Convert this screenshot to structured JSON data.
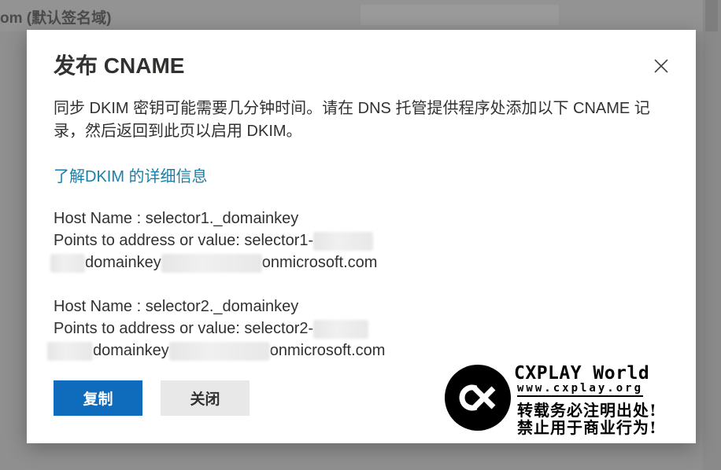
{
  "background": {
    "page_title": "om (默认签名域)"
  },
  "dialog": {
    "title": "发布 CNAME",
    "description": "同步 DKIM 密钥可能需要几分钟时间。请在 DNS 托管提供程序处添加以下 CNAME 记录，然后返回到此页以启用 DKIM。",
    "learn_more_link": "了解DKIM 的详细信息",
    "records": [
      {
        "host_name": "Host Name : selector1._domainkey",
        "points_to_prefix": "Points to address or value: selector1-",
        "value_part_1": "domainkey",
        "value_part_2": "onmicrosoft.com"
      },
      {
        "host_name": "Host Name : selector2._domainkey",
        "points_to_prefix": "Points to address or value: selector2-",
        "value_part_1": "domainkey",
        "value_part_2": "onmicrosoft.com"
      }
    ],
    "copy_button_label": "复制",
    "close_button_label": "关闭",
    "close_icon": "close-icon"
  },
  "watermark": {
    "logo_icon": "cx-logo-icon",
    "title": "CXPLAY World",
    "url": "www.cxplay.org",
    "line1": "转载务必注明出处!",
    "line2": "禁止用于商业行为!"
  },
  "colors": {
    "overlay": "#8f8f8f",
    "primary": "#0f6cbd",
    "link": "#1b7fa8",
    "text": "#323130",
    "secondary_button": "#e8e8e8"
  }
}
